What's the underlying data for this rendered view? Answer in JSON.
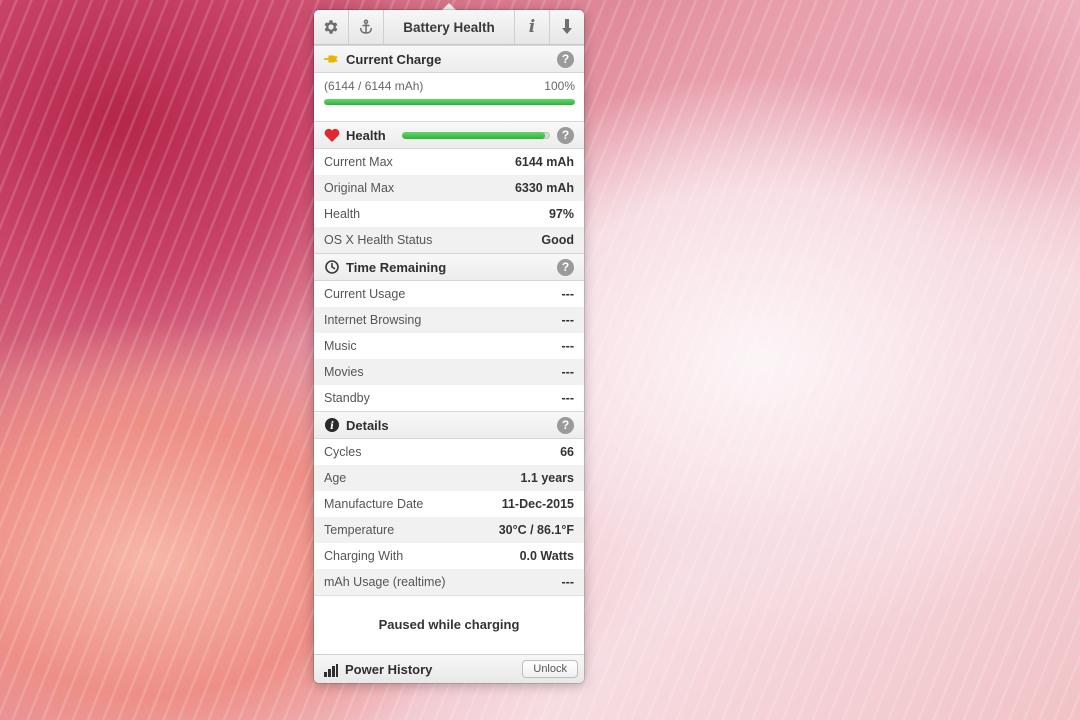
{
  "toolbar": {
    "title": "Battery Health",
    "left_icons": [
      "gear-icon",
      "anchor-icon"
    ],
    "right_icons": [
      "info-icon",
      "download-icon"
    ]
  },
  "current_charge": {
    "title": "Current Charge",
    "icon": "plug-icon",
    "mah_text": "(6144 / 6144 mAh)",
    "percent_text": "100%",
    "level": 1.0,
    "help": "?"
  },
  "health": {
    "title": "Health",
    "icon": "heart-icon",
    "level": 0.97,
    "help": "?",
    "rows": [
      {
        "label": "Current Max",
        "value": "6144 mAh"
      },
      {
        "label": "Original Max",
        "value": "6330 mAh"
      },
      {
        "label": "Health",
        "value": "97%"
      },
      {
        "label": "OS X Health Status",
        "value": "Good"
      }
    ]
  },
  "time_remaining": {
    "title": "Time Remaining",
    "icon": "clock-icon",
    "help": "?",
    "rows": [
      {
        "label": "Current Usage",
        "value": "---"
      },
      {
        "label": "Internet Browsing",
        "value": "---"
      },
      {
        "label": "Music",
        "value": "---"
      },
      {
        "label": "Movies",
        "value": "---"
      },
      {
        "label": "Standby",
        "value": "---"
      }
    ]
  },
  "details": {
    "title": "Details",
    "icon": "info-circle-icon",
    "help": "?",
    "rows": [
      {
        "label": "Cycles",
        "value": "66"
      },
      {
        "label": "Age",
        "value": "1.1 years"
      },
      {
        "label": "Manufacture Date",
        "value": "11-Dec-2015"
      },
      {
        "label": "Temperature",
        "value": "30°C / 86.1°F"
      },
      {
        "label": "Charging With",
        "value": "0.0 Watts"
      },
      {
        "label": "mAh Usage (realtime)",
        "value": "---"
      }
    ],
    "paused_text": "Paused while charging"
  },
  "power_history": {
    "title": "Power History",
    "icon": "bar-chart-icon",
    "unlock_label": "Unlock"
  },
  "colors": {
    "bar_green": "#3cc447",
    "heart_red": "#e0282e",
    "plug_yellow": "#e8b400"
  }
}
